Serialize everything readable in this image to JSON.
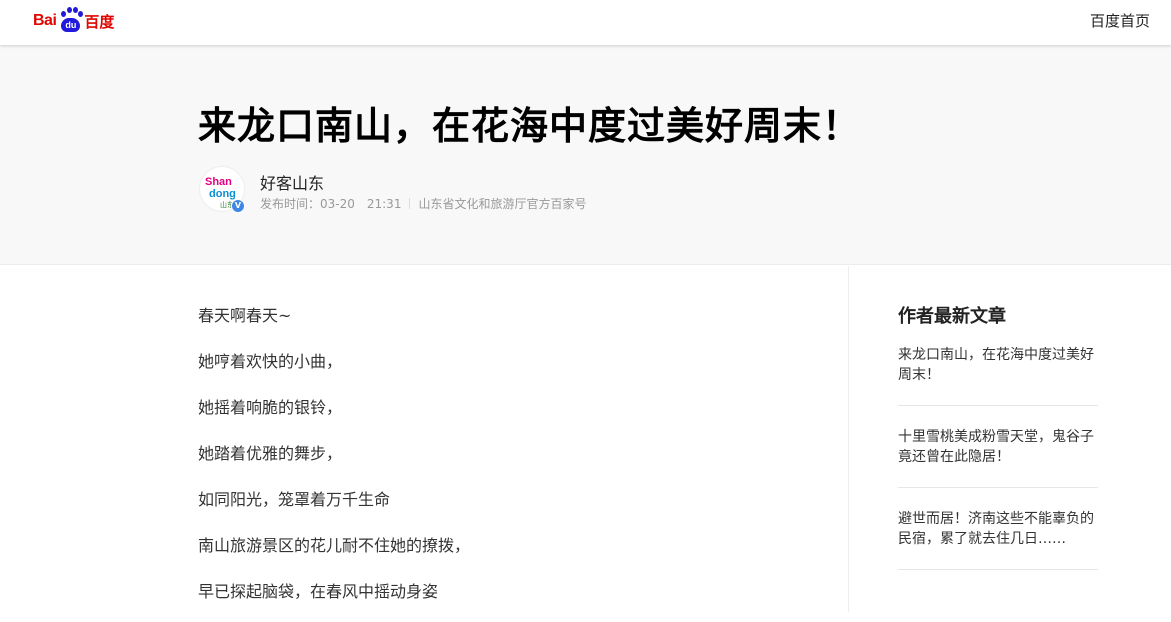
{
  "topbar": {
    "logo_bai": "Bai",
    "logo_du": "du",
    "logo_cn": "百度",
    "home_label": "百度首页"
  },
  "header": {
    "title": "来龙口南山，在花海中度过美好周末！",
    "author": "好客山东",
    "avatar_text": [
      "Shan",
      "dong",
      "山东"
    ],
    "publish_time": "发布时间：03-20　21:31",
    "source": "山东省文化和旅游厅官方百家号"
  },
  "article": {
    "paragraphs": [
      "春天啊春天~",
      "她哼着欢快的小曲，",
      "她摇着响脆的银铃，",
      "她踏着优雅的舞步，",
      "如同阳光，笼罩着万千生命",
      "南山旅游景区的花儿耐不住她的撩拨，",
      "早已探起脑袋，在春风中摇动身姿"
    ]
  },
  "sidebar": {
    "heading": "作者最新文章",
    "articles": [
      "来龙口南山，在花海中度过美好周末！",
      "十里雪桃美成粉雪天堂，鬼谷子竟还曾在此隐居！",
      "避世而居！济南这些不能辜负的民宿，累了就去住几日……"
    ]
  },
  "colors": {
    "logo_red": "#e10602",
    "logo_blue": "#2319dc",
    "header_bg": "#f8f8f8",
    "verify_blue": "#3d87e6"
  }
}
